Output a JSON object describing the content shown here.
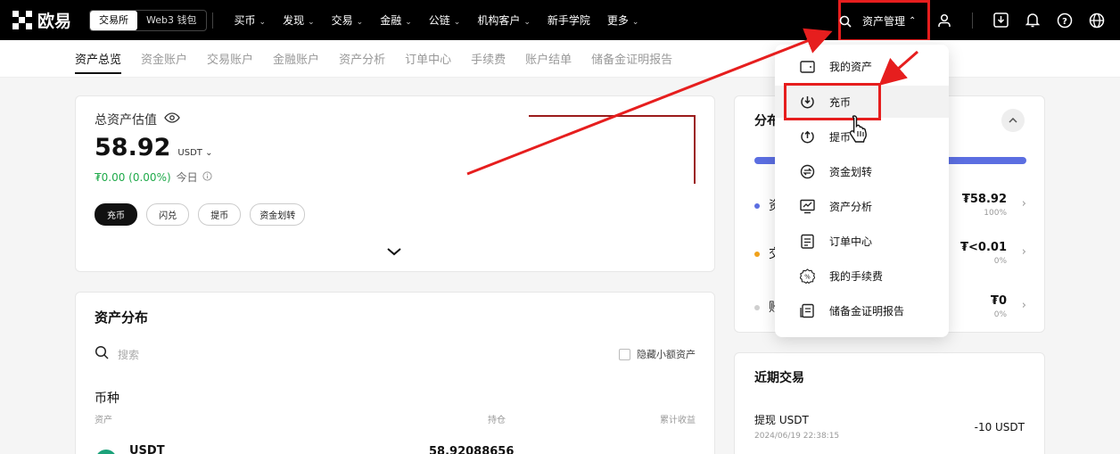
{
  "topbar": {
    "logo": "欧易",
    "segment": [
      "交易所",
      "Web3 钱包"
    ],
    "nav": [
      {
        "label": "买币",
        "has_chevron": true
      },
      {
        "label": "发现",
        "has_chevron": true
      },
      {
        "label": "交易",
        "has_chevron": true
      },
      {
        "label": "金融",
        "has_chevron": true
      },
      {
        "label": "公链",
        "has_chevron": true
      },
      {
        "label": "机构客户",
        "has_chevron": true
      },
      {
        "label": "新手学院",
        "has_chevron": false
      },
      {
        "label": "更多",
        "has_chevron": true
      }
    ],
    "asset_management": "资产管理"
  },
  "subnav": [
    "资产总览",
    "资金账户",
    "交易账户",
    "金融账户",
    "资产分析",
    "订单中心",
    "手续费",
    "账户结单",
    "储备金证明报告"
  ],
  "overview": {
    "title": "总资产估值",
    "value": "58.92",
    "unit": "USDT",
    "change": "₮0.00 (0.00%)",
    "today": "今日",
    "actions": [
      "充币",
      "闪兑",
      "提币",
      "资金划转"
    ]
  },
  "distribution": {
    "title": "资产分布",
    "search_placeholder": "搜索",
    "hide_small": "隐藏小额资产",
    "tab": "币种",
    "col_asset": "资产",
    "col_holding": "持仓",
    "col_profit": "累计收益",
    "first_coin": "USDT",
    "first_holding": "58.92088656"
  },
  "right_panel": {
    "title_partial": "分布",
    "rows": [
      {
        "label": "资",
        "amount": "₮58.92",
        "pct": "100%",
        "dot": "#5b6ee1"
      },
      {
        "label": "交",
        "amount": "₮<0.01",
        "pct": "0%",
        "dot": "#f0a11b"
      },
      {
        "label": "账",
        "amount": "₮0",
        "pct": "0%",
        "dot": "#cfcfcf"
      }
    ]
  },
  "recent": {
    "title": "近期交易",
    "item_title": "提现 USDT",
    "item_time": "2024/06/19 22:38:15",
    "item_amount": "-10 USDT"
  },
  "dropdown": {
    "items": [
      "我的资产",
      "充币",
      "提币",
      "资金划转",
      "资产分析",
      "订单中心",
      "我的手续费",
      "储备金证明报告"
    ]
  },
  "colors": {
    "accent_red": "#e61e1e",
    "green": "#1faa4a",
    "topbar": "#000000"
  }
}
